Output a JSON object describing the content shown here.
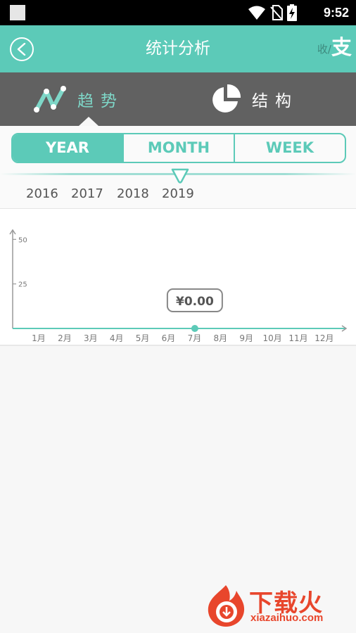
{
  "status_bar": {
    "time": "9:52"
  },
  "app_bar": {
    "title": "统计分析",
    "toggle_inactive": "收/",
    "toggle_active": "支"
  },
  "modes": [
    {
      "label": "趋势",
      "icon": "trend-line-icon",
      "active": true
    },
    {
      "label": "结构",
      "icon": "pie-chart-icon",
      "active": false
    }
  ],
  "periods": [
    {
      "label": "YEAR",
      "active": true
    },
    {
      "label": "MONTH",
      "active": false
    },
    {
      "label": "WEEK",
      "active": false
    }
  ],
  "years": [
    "2016",
    "2017",
    "2018",
    "2019"
  ],
  "selected_year": "2019",
  "chart_data": {
    "type": "line",
    "categories": [
      "1月",
      "2月",
      "3月",
      "4月",
      "5月",
      "6月",
      "7月",
      "8月",
      "9月",
      "10月",
      "11月",
      "12月"
    ],
    "y_ticks": [
      "25",
      "50"
    ],
    "ylim": [
      0,
      60
    ],
    "series": [
      {
        "values": [
          0
        ]
      }
    ],
    "highlight": {
      "index": 6,
      "label": "¥0.00"
    },
    "colors": {
      "accent": "#5ccab8",
      "axis": "#999999"
    }
  },
  "watermark": {
    "text": "下载火",
    "sub": "xiazaihuo.com"
  }
}
